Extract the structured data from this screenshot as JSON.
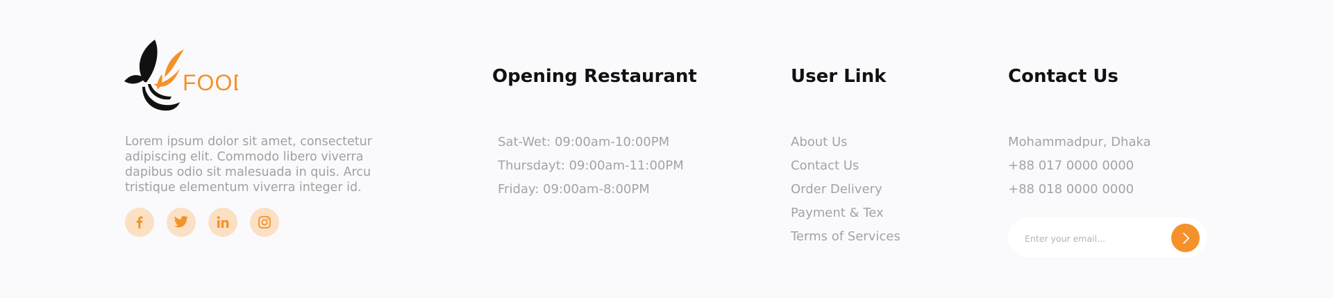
{
  "brand": {
    "logo_text": "FOOD",
    "logo_icon": "leaf-bowl-icon",
    "about": "Lorem ipsum dolor sit amet, consectetur adipiscing elit. Commodo libero viverra dapibus odio sit malesuada in quis. Arcu tristique elementum viverra integer id.",
    "social": [
      {
        "name": "facebook",
        "icon": "facebook-icon"
      },
      {
        "name": "twitter",
        "icon": "twitter-icon"
      },
      {
        "name": "linkedin",
        "icon": "linkedin-icon"
      },
      {
        "name": "instagram",
        "icon": "instagram-icon"
      }
    ]
  },
  "opening": {
    "title": "Opening Restaurant",
    "items": [
      "Sat-Wet: 09:00am-10:00PM",
      "Thursdayt: 09:00am-11:00PM",
      "Friday: 09:00am-8:00PM"
    ]
  },
  "user_links": {
    "title": "User Link",
    "items": [
      "About Us",
      "Contact Us",
      "Order Delivery",
      "Payment & Tex",
      "Terms of Services"
    ]
  },
  "contact": {
    "title": "Contact Us",
    "items": [
      "Mohammadpur, Dhaka",
      "+88 017 0000 0000",
      "+88 018 0000 0000"
    ],
    "email_placeholder": "Enter your email...",
    "submit_icon": "chevron-right-icon"
  },
  "colors": {
    "accent": "#f5912a",
    "social_bg": "#fbe0c4",
    "background": "#fafafd",
    "muted_text": "#a3a3a3",
    "heading": "#111111"
  }
}
